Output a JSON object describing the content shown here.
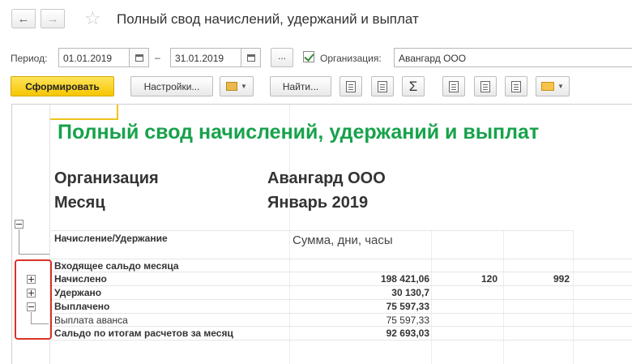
{
  "window": {
    "title": "Полный свод начислений, удержаний и выплат",
    "back_icon": "←",
    "forward_icon": "→",
    "star_icon": "☆"
  },
  "filters": {
    "period_label": "Период:",
    "date_from": "01.01.2019",
    "dash": "–",
    "date_to": "31.01.2019",
    "dots_label": "...",
    "org_checked": true,
    "org_label": "Организация:",
    "org_value": "Авангард ООО"
  },
  "toolbar": {
    "generate_label": "Сформировать",
    "settings_label": "Настройки...",
    "find_label": "Найти...",
    "sum_icon": "Σ"
  },
  "report": {
    "title": "Полный свод начислений, удержаний и выплат",
    "org_label": "Организация",
    "org_value": "Авангард ООО",
    "month_label": "Месяц",
    "month_value": "Январь 2019",
    "col_header_1": "Начисление/Удержание",
    "col_header_2": "Сумма, дни, часы",
    "rows": [
      {
        "label": "Входящее сальдо месяца",
        "sum": "",
        "days": "",
        "hours": ""
      },
      {
        "label": "Начислено",
        "sum": "198 421,06",
        "days": "120",
        "hours": "992"
      },
      {
        "label": "Удержано",
        "sum": "30 130,7",
        "days": "",
        "hours": ""
      },
      {
        "label": "Выплачено",
        "sum": "75 597,33",
        "days": "",
        "hours": ""
      },
      {
        "label": "Выплата аванса",
        "sum": "75 597,33",
        "days": "",
        "hours": ""
      },
      {
        "label": "Сальдо по итогам расчетов за месяц",
        "sum": "92 693,03",
        "days": "",
        "hours": ""
      }
    ]
  }
}
